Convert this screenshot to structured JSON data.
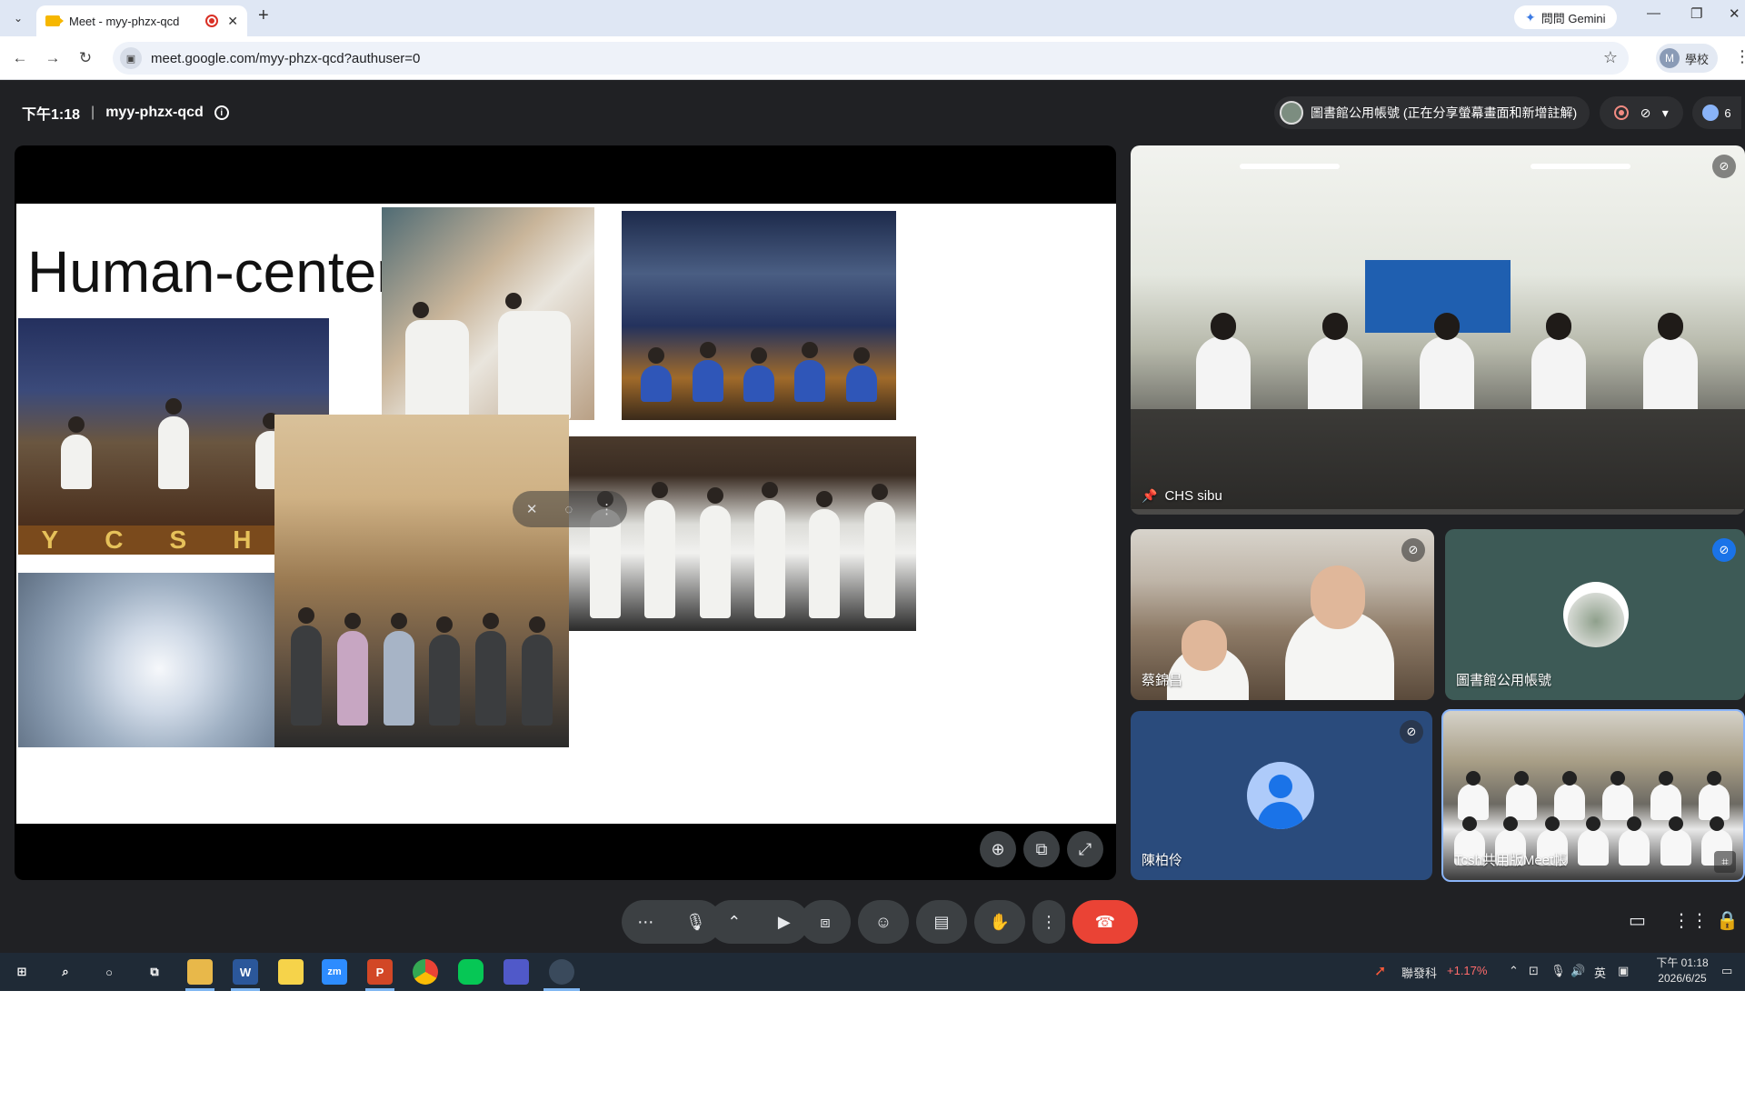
{
  "browser": {
    "tab_title": "Meet - myy-phzx-qcd",
    "tab_close": "✕",
    "new_tab": "+",
    "gemini_label": "問問 Gemini",
    "url": "meet.google.com/myy-phzx-qcd?authuser=0",
    "profile_initial": "M",
    "profile_label": "學校",
    "window_minimize": "—",
    "window_restore": "❐",
    "window_close": "✕"
  },
  "meet": {
    "time": "下午1:18",
    "separator": "|",
    "meeting_code": "myy-phzx-qcd",
    "info_glyph": "i",
    "presenter_notice": "圖書館公用帳號 (正在分享螢幕畫面和新增註解)",
    "participant_count": "6",
    "slide": {
      "title": "Human-centered",
      "banner_letters": [
        "Y",
        "C",
        "S",
        "H"
      ]
    },
    "tiles": [
      {
        "name": "CHS sibu",
        "pinned": true
      },
      {
        "name": "蔡錦昌",
        "pinned": false
      },
      {
        "name": "圖書館公用帳號",
        "pinned": false
      },
      {
        "name": "陳柏伶",
        "pinned": false
      },
      {
        "name": "Tcsh共用版Meet帳",
        "pinned": false
      }
    ]
  },
  "taskbar": {
    "stock_name": "聯發科",
    "stock_change": "+1.17%",
    "ime": "英",
    "clock_time": "下午 01:18",
    "clock_date": "2026/6/25",
    "apps": [
      "W",
      "zm",
      "P"
    ]
  },
  "colors": {
    "meet_bg": "#202124",
    "control_bg": "#3c4043",
    "hangup": "#ea4335",
    "accent_blue": "#1a73e8",
    "stock_red": "#ff6b6b",
    "taskbar_bg": "#1f2a36"
  }
}
